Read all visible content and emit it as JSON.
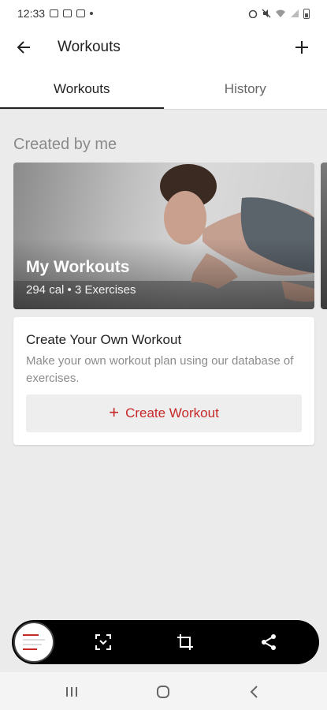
{
  "status_bar": {
    "time": "12:33"
  },
  "app_bar": {
    "title": "Workouts"
  },
  "tabs": [
    {
      "label": "Workouts",
      "active": true
    },
    {
      "label": "History",
      "active": false
    }
  ],
  "section": {
    "title": "Created by me"
  },
  "workout_card": {
    "title": "My Workouts",
    "subtitle": "294 cal • 3 Exercises"
  },
  "create_card": {
    "title": "Create Your Own Workout",
    "description": "Make your own workout plan using our database of exercises.",
    "button_label": "Create Workout"
  },
  "colors": {
    "accent": "#c62828",
    "background": "#ebebeb"
  },
  "icons": [
    "arrow-back-icon",
    "plus-icon",
    "screenshot-icon",
    "crop-icon",
    "share-icon",
    "recent-apps-icon",
    "home-icon",
    "back-nav-icon"
  ]
}
